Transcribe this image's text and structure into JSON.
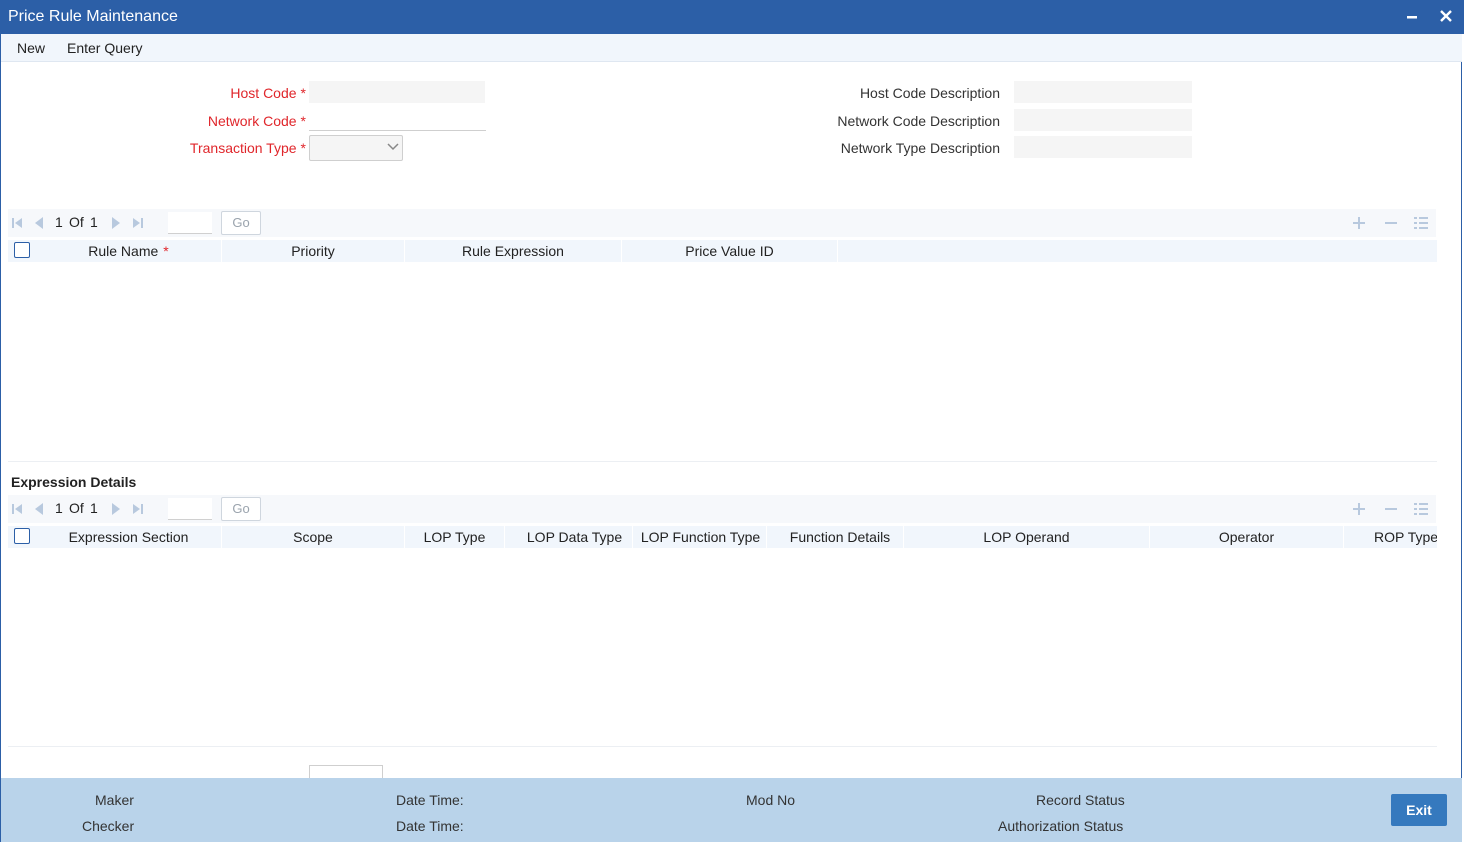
{
  "window": {
    "title": "Price Rule Maintenance"
  },
  "toolbar": {
    "new_label": "New",
    "enter_query_label": "Enter Query"
  },
  "form": {
    "host_code_label": "Host Code",
    "network_code_label": "Network Code",
    "transaction_type_label": "Transaction Type",
    "required_mark": "*",
    "host_code_value": "",
    "network_code_value": "",
    "transaction_type_value": "",
    "host_code_desc_label": "Host Code Description",
    "network_code_desc_label": "Network Code Description",
    "network_type_desc_label": "Network Type Description"
  },
  "rules_grid": {
    "page_current": "1",
    "page_of": "Of",
    "page_total": "1",
    "go_label": "Go",
    "columns": [
      "Rule Name",
      "Priority",
      "Rule Expression",
      "Price Value ID"
    ],
    "rows": []
  },
  "expression_details": {
    "title": "Expression Details",
    "page_current": "1",
    "page_of": "Of",
    "page_total": "1",
    "go_label": "Go",
    "columns": [
      "Expression Section",
      "Scope",
      "LOP Type",
      "LOP Data Type",
      "LOP Function Type",
      "Function Details",
      "LOP Operand",
      "Operator",
      "ROP Type"
    ],
    "rows": []
  },
  "footer": {
    "maker_label": "Maker",
    "checker_label": "Checker",
    "date_time_label": "Date Time:",
    "mod_no_label": "Mod No",
    "record_status_label": "Record Status",
    "authorization_status_label": "Authorization Status",
    "exit_label": "Exit"
  },
  "colors": {
    "title_bar": "#2c5fa7",
    "required": "#e0262b",
    "footer_bg": "#b9d3ea",
    "exit_button": "#3579be"
  }
}
